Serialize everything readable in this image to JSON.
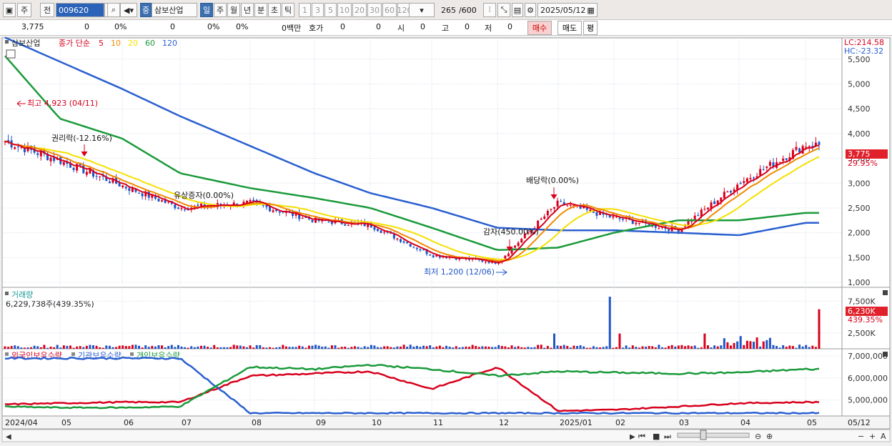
{
  "toolbar": {
    "mode": "주",
    "prev": "전",
    "code": "009620",
    "market_badge": "중",
    "name": "삼보산업",
    "periods": [
      "일",
      "주",
      "월",
      "년",
      "분",
      "초",
      "틱"
    ],
    "intervals": [
      "1",
      "3",
      "5",
      "10",
      "20",
      "30",
      "60",
      "120"
    ],
    "count": "265",
    "count_total": "/600",
    "date": "2025/05/12"
  },
  "info": {
    "price": "3,775",
    "change": "0",
    "change_pct": "0%",
    "volume": "0",
    "vol_pct": "0%",
    "pct2": "0%",
    "amount": "0백만",
    "hoga_label": "호가",
    "hoga1": "0",
    "hoga2": "0",
    "open_label": "시",
    "open_val": "0",
    "high_label": "고",
    "high_val": "0",
    "low_label": "저",
    "low_val": "0",
    "buy": "매수",
    "sell": "매도",
    "avg": "평"
  },
  "price_panel": {
    "stock_label": "삼보산업",
    "ma_label": "종가 단순",
    "ma_periods": [
      "5",
      "10",
      "20",
      "60",
      "120"
    ],
    "ma_colors": [
      "#d7001c",
      "#f08a00",
      "#f5e000",
      "#1a9a3a",
      "#2a5fd0"
    ],
    "lc": "LC:214.58",
    "hc": "HC:-23.32",
    "current_price": "3,775",
    "current_pct": "29.95%",
    "annotations": {
      "high": "최고 4,923 (04/11)",
      "rights": "권리락(-12.16%)",
      "bonus": "유상증자(0.00%)",
      "dividend": "배당락(0.00%)",
      "reduction": "감자(450.00%)",
      "low": "최저 1,200 (12/06)"
    }
  },
  "volume_panel": {
    "title": "거래량",
    "value": "6,229,738주(439.35%)",
    "current": "6,230K",
    "current_pct": "439.35%"
  },
  "holdings_panel": {
    "legend": [
      "외국인보유수량",
      "기관보유수량",
      "개인보유수량"
    ],
    "colors": [
      "#d7001c",
      "#2a5fd0",
      "#1a9a3a"
    ]
  },
  "axis": {
    "price_ticks": [
      "5,500",
      "5,000",
      "4,500",
      "4,000",
      "3,500",
      "3,000",
      "2,500",
      "2,000",
      "1,500",
      "1,000"
    ],
    "volume_ticks": [
      "7,500K",
      "2,500K"
    ],
    "holdings_ticks": [
      "7,000,000",
      "6,000,000",
      "5,000,000"
    ],
    "x_labels": [
      "2024/04",
      "05",
      "06",
      "07",
      "08",
      "09",
      "10",
      "11",
      "12",
      "2025/01",
      "02",
      "03",
      "04",
      "05"
    ],
    "right_date": "05/12"
  },
  "chart_data": {
    "type": "line",
    "title": "삼보산업",
    "x": [
      "2024/04",
      "05",
      "06",
      "07",
      "08",
      "09",
      "10",
      "11",
      "12",
      "2025/01",
      "02",
      "03",
      "04",
      "05"
    ],
    "ylim": [
      1000,
      5800
    ],
    "series": [
      {
        "name": "종가",
        "values": [
          3850,
          3450,
          2950,
          2500,
          2600,
          2250,
          2150,
          1550,
          1400,
          2600,
          2300,
          2050,
          3000,
          3775
        ]
      },
      {
        "name": "60",
        "values": [
          5600,
          4300,
          3900,
          3200,
          2900,
          2700,
          2500,
          2100,
          1650,
          1700,
          2000,
          2250,
          2250,
          2400
        ]
      },
      {
        "name": "120",
        "values": [
          5950,
          5450,
          4900,
          4350,
          3750,
          3200,
          2800,
          2500,
          2100,
          2050,
          2050,
          2000,
          1950,
          2200
        ]
      }
    ]
  }
}
